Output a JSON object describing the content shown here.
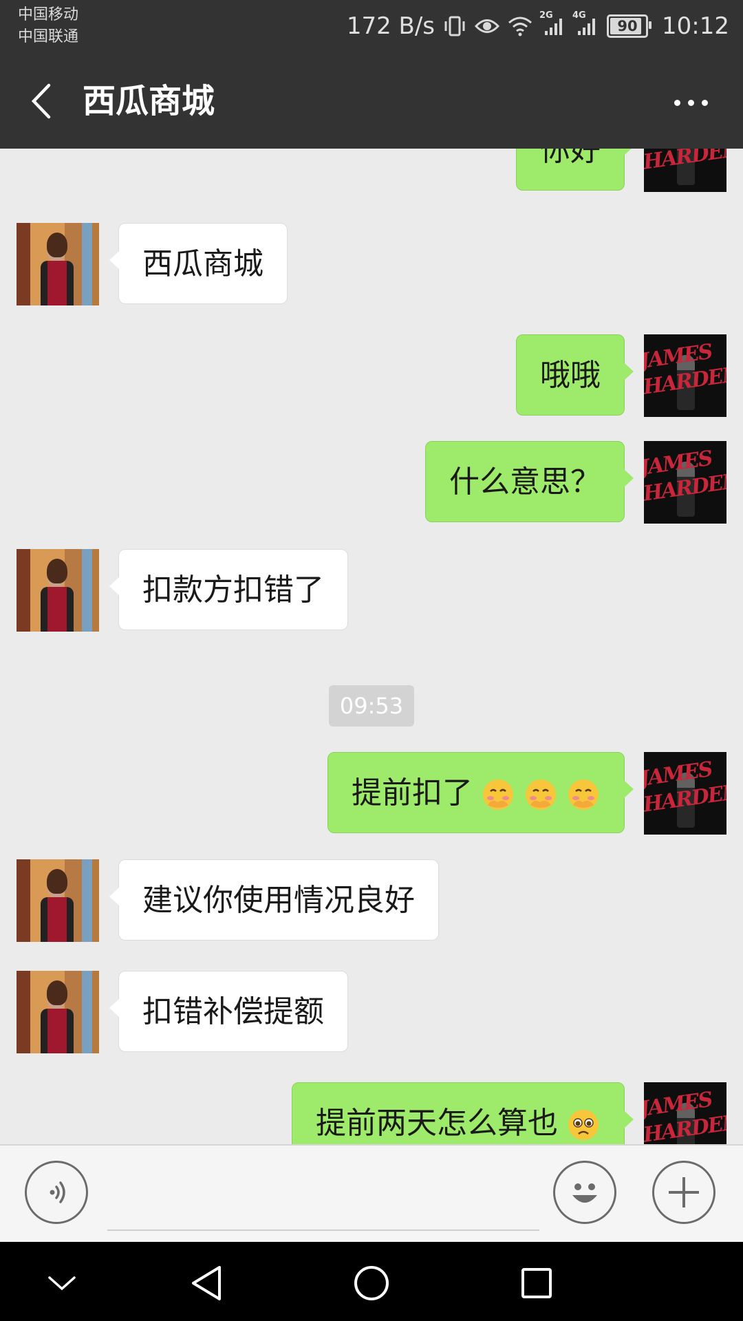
{
  "status_bar": {
    "carrier_1": "中国移动",
    "carrier_2": "中国联通",
    "net_speed": "172 B/s",
    "network_2g": "2G",
    "network_4g": "4G",
    "battery": "90",
    "time": "10:12",
    "icons": [
      "vibrate-icon",
      "eye-icon",
      "wifi-icon",
      "signal-2g-icon",
      "signal-4g-icon",
      "battery-icon"
    ]
  },
  "header": {
    "title": "西瓜商城",
    "back_icon": "chevron-left-icon",
    "more_icon": "more-dots-icon"
  },
  "messages": [
    {
      "side": "right",
      "text": "你好"
    },
    {
      "side": "left",
      "text": "西瓜商城"
    },
    {
      "side": "right",
      "text": "哦哦"
    },
    {
      "side": "right",
      "text": "什么意思？"
    },
    {
      "side": "left",
      "text": "扣款方扣错了"
    },
    {
      "type": "time",
      "text": "09:53"
    },
    {
      "side": "right",
      "text": "提前扣了",
      "emojis": [
        "face-with-hand-over-mouth-emoji",
        "face-with-hand-over-mouth-emoji",
        "face-with-hand-over-mouth-emoji"
      ]
    },
    {
      "side": "left",
      "text": "建议你使用情况良好"
    },
    {
      "side": "left",
      "text": "扣错补偿提额"
    },
    {
      "side": "right",
      "text": "提前两天怎么算也",
      "emojis": [
        "pleading-face-emoji"
      ]
    }
  ],
  "input_bar": {
    "voice_icon": "voice-icon",
    "input_value": "",
    "emoji_icon": "smiley-icon",
    "plus_icon": "plus-icon"
  },
  "colors": {
    "header_bg": "#333333",
    "chat_bg": "#ebebeb",
    "sent_bubble": "#9eea6a",
    "received_bubble": "#ffffff"
  }
}
